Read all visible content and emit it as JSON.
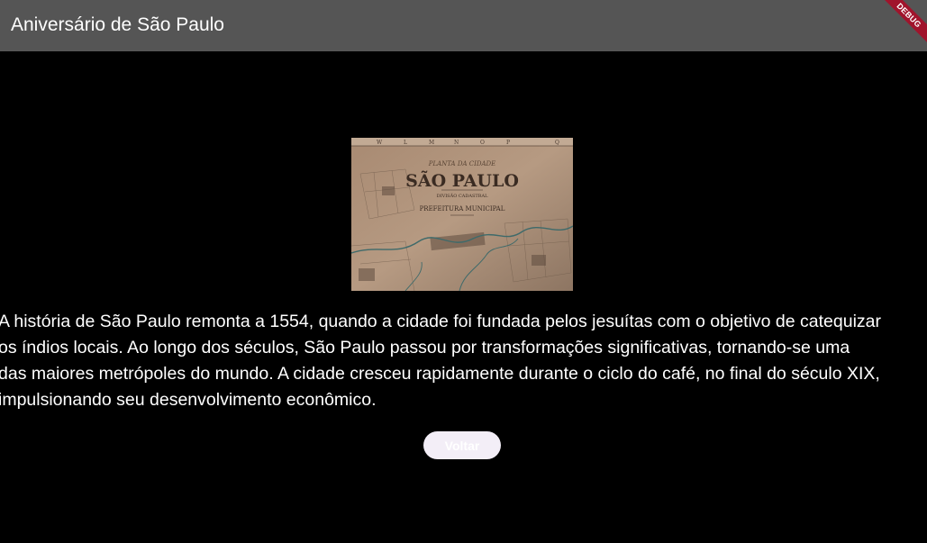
{
  "appbar": {
    "title": "Aniversário de São Paulo",
    "debug_banner": "DEBUG"
  },
  "map": {
    "header": "PLANTA DA CIDADE",
    "title": "SÃO PAULO",
    "subtitle": "DIVISÃO CADASTRAL",
    "agency": "PREFEITURA MUNICIPAL",
    "compass_letters": [
      "W",
      "L",
      "M",
      "N",
      "O",
      "P",
      "Q"
    ]
  },
  "history": {
    "lines": [
      "A história de São Paulo remonta a 1554, quando a cidade foi fundada pelos jesuítas com o objetivo de catequizar",
      "os índios locais. Ao longo dos séculos, São Paulo passou por transformações significativas, tornando-se uma",
      "das maiores metrópoles do mundo. A cidade cresceu rapidamente durante o ciclo do café, no final do século XIX,",
      "impulsionando seu desenvolvimento econômico."
    ]
  },
  "actions": {
    "back_label": "Voltar"
  },
  "colors": {
    "appbar": "#555555",
    "background": "#000000",
    "button": "#f3eef7",
    "debug": "#a0142c"
  }
}
